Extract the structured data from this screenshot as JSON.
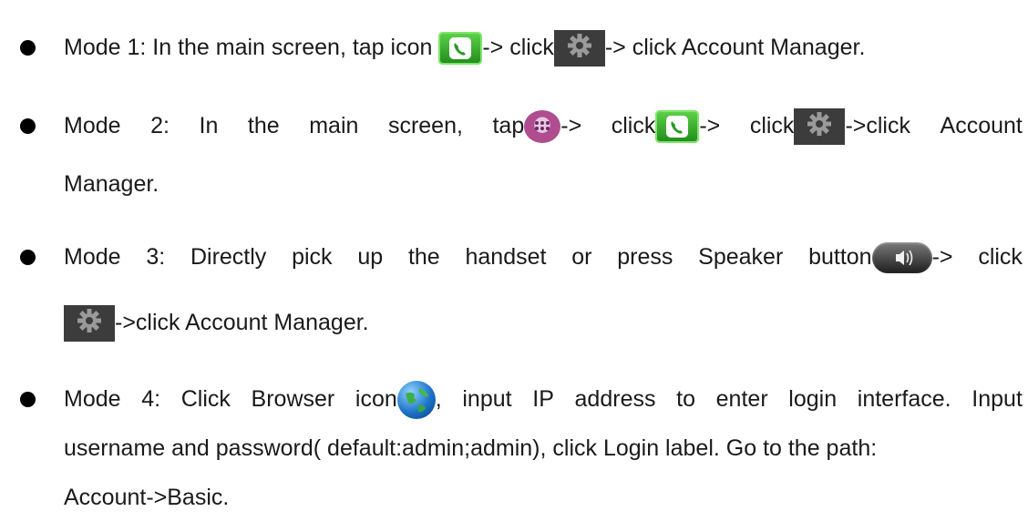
{
  "items": [
    {
      "line1": {
        "t1": "Mode 1: In the main screen, tap icon ",
        "t2": "-> click",
        "t3": "-> click Account Manager."
      }
    },
    {
      "line1": {
        "w1": "Mode",
        "w2": "2:",
        "w3": "In",
        "w4": "the",
        "w5": "main",
        "w6": "screen,",
        "w7": "tap",
        "w8": "->",
        "w9": "click",
        "w10": "->",
        "w11": "click",
        "w12": "->click",
        "w13": "Account"
      },
      "line2": "Manager."
    },
    {
      "line1": {
        "w1": "Mode",
        "w2": "3:",
        "w3": "Directly",
        "w4": "pick",
        "w5": "up",
        "w6": "the",
        "w7": "handset",
        "w8": "or",
        "w9": "press",
        "w10": "Speaker",
        "w11": "button",
        "w12": "->",
        "w13": "click"
      },
      "line2": "->click Account Manager."
    },
    {
      "line1": {
        "w1": "Mode",
        "w2": "4:",
        "w3": "Click",
        "w4": "Browser",
        "w5": "icon",
        "w6": ",",
        "w7": "input",
        "w8": "IP",
        "w9": "address",
        "w10": "to",
        "w11": "enter",
        "w12": "login",
        "w13": "interface.",
        "w14": "Input"
      },
      "line2": "username and password( default:admin;admin), click Login label. Go to the path:",
      "line3": "Account->Basic."
    }
  ],
  "icons": {
    "phone": "phone-app-icon",
    "gear": "settings-gear-icon",
    "apps": "app-drawer-icon",
    "speaker": "speaker-button-icon",
    "globe": "browser-globe-icon"
  }
}
